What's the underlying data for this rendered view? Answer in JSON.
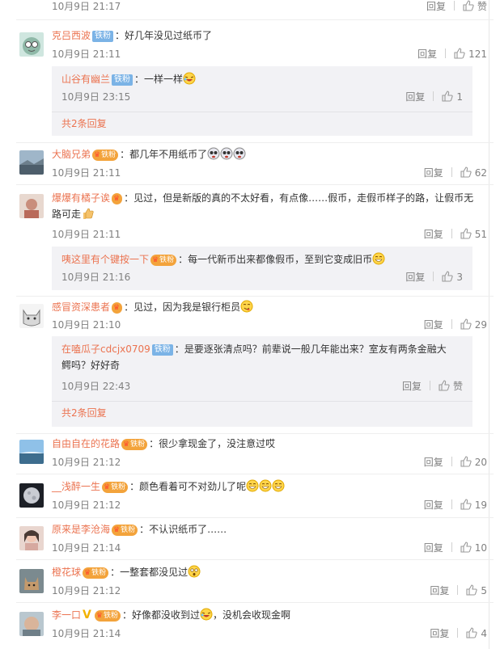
{
  "labels": {
    "reply": "回复",
    "more_replies_2": "共2条回复",
    "verified": "V"
  },
  "top_partial": {
    "time": "10月9日 21:17",
    "like": "赞"
  },
  "comments": [
    {
      "user": "克吕西波",
      "badge": "铁粉",
      "text": "：好几年没见过纸币了",
      "time": "10月9日 21:11",
      "likes": "121",
      "avatar": "cartoon-avatar",
      "reply": {
        "user": "山谷有幽兰",
        "badge": "铁粉",
        "text": "：一样一样",
        "time": "10月9日 23:15",
        "likes": "1"
      }
    },
    {
      "user": "大脑兄弟",
      "badge": "铁粉",
      "text": "：都几年不用纸币了",
      "time": "10月9日 21:11",
      "likes": "62",
      "avatar": "landscape-avatar"
    },
    {
      "user": "爆爆有橘子诶",
      "badge": "",
      "text": "：见过，但是新版的真的不太好看，有点像……假币，走假币样子的路，让假币无路可走",
      "time": "10月9日 21:11",
      "likes": "51",
      "avatar": "photo-avatar",
      "reply": {
        "user": "咦这里有个键按一下",
        "badge": "铁粉",
        "text": "：每一代新币出来都像假币，至到它变成旧币",
        "time": "10月9日 21:16",
        "likes": "3"
      }
    },
    {
      "user": "感冒资深患者",
      "badge": "",
      "text": "：见过，因为我是银行柜员",
      "time": "10月9日 21:10",
      "likes": "29",
      "avatar": "cat-avatar",
      "reply": {
        "user": "在嗑瓜子cdcjx0709",
        "badge": "铁粉",
        "text": "：是要逐张清点吗？前辈说一般几年能出来？室友有两条金融大鳄吗？好好奇",
        "time": "10月9日 22:43",
        "likes": "赞"
      }
    },
    {
      "user": "自由自在的花路",
      "badge": "铁粉",
      "text": "：很少拿现金了，没注意过哎",
      "time": "10月9日 21:12",
      "likes": "20",
      "avatar": "sky-avatar"
    },
    {
      "user": "__浅醉一生",
      "badge": "铁粉",
      "text": "：颜色看着可不对劲儿了呢",
      "time": "10月9日 21:12",
      "likes": "19",
      "avatar": "moon-avatar"
    },
    {
      "user": "原来是李沧海",
      "badge": "铁粉",
      "text": "：不认识纸币了……",
      "time": "10月9日 21:14",
      "likes": "10",
      "avatar": "girl-avatar"
    },
    {
      "user": "橙花球",
      "badge": "铁粉",
      "text": "：一整套都没见过",
      "time": "10月9日 21:12",
      "likes": "5",
      "avatar": "cat-photo-avatar"
    },
    {
      "user": "李一口",
      "badge": "铁粉",
      "text": "：好像都没收到过",
      "text2": "，没机会收现金啊",
      "time": "10月9日 21:14",
      "likes": "4",
      "avatar": "face-avatar"
    }
  ]
}
